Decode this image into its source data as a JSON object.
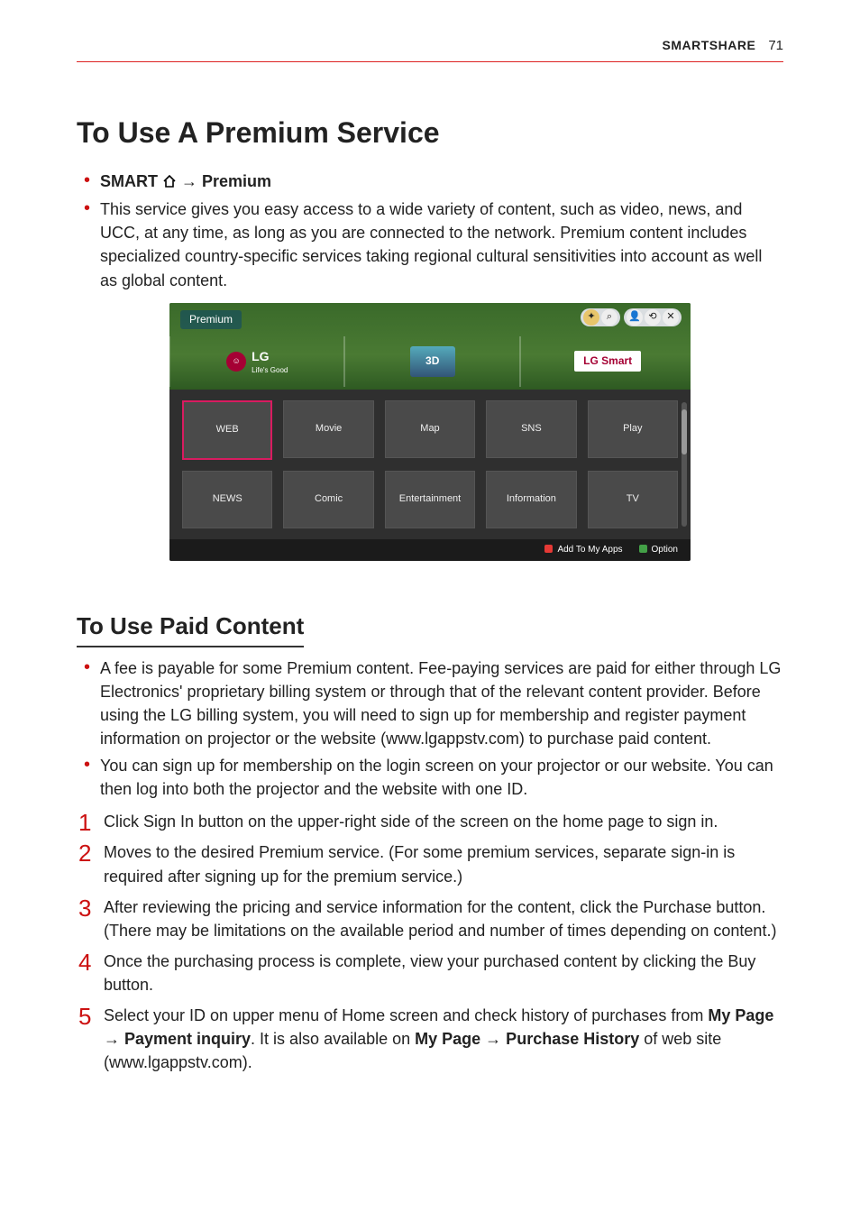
{
  "header": {
    "section": "SMARTSHARE",
    "page_number": "71"
  },
  "title": "To Use A Premium Service",
  "nav_bullet": {
    "prefix": "SMART ",
    "arrow": " → ",
    "target": "Premium"
  },
  "intro_bullet": "This service gives you easy access to a wide variety of content, such as video, news, and UCC, at any time, as long as you are connected to the network. Premium content includes specialized country-specific services taking regional cultural sensitivities into account as well as global content.",
  "screenshot": {
    "title": "Premium",
    "banners": {
      "lg_text": "LG",
      "lg_sub": "Life's Good",
      "threed": "3D",
      "smart": "LG Smart"
    },
    "top_icons": {
      "search": "⌕",
      "user": "👤",
      "back": "⟲",
      "close": "✕"
    },
    "tiles_row1": [
      "WEB",
      "Movie",
      "Map",
      "SNS",
      "Play"
    ],
    "tiles_row2": [
      "NEWS",
      "Comic",
      "Entertainment",
      "Information",
      "TV"
    ],
    "footer": {
      "add": "Add To My Apps",
      "option": "Option"
    }
  },
  "section2_title": "To Use Paid Content",
  "section2_bullets": [
    "A fee is payable for some Premium content. Fee-paying services are paid for either through LG Electronics' proprietary billing system or through that of the relevant content provider. Before using the LG billing system, you will need to sign up for membership and register payment information on projector or the website (www.lgappstv.com) to purchase paid content.",
    "You can sign up for membership on the login screen on your projector or our website. You can then log into both the projector and the website with one ID."
  ],
  "steps": [
    "Click Sign In button on the upper-right side of the screen on the home page to sign in.",
    "Moves to the desired Premium service. (For some premium services, separate sign-in is required after signing up for the premium service.)",
    "After reviewing the pricing and service information for the content, click the Purchase button. (There may be limitations on the available period and number of times depending on content.)",
    "Once the purchasing process is complete, view your purchased content by clicking the Buy button."
  ],
  "step5": {
    "pre": "Select your ID on upper menu of Home screen and check history of purchases from ",
    "bold1": "My Page → Payment inquiry",
    "mid": ". It is also available on ",
    "bold2": "My Page → Purchase History",
    "post": " of web site (www.lgappstv.com)."
  }
}
